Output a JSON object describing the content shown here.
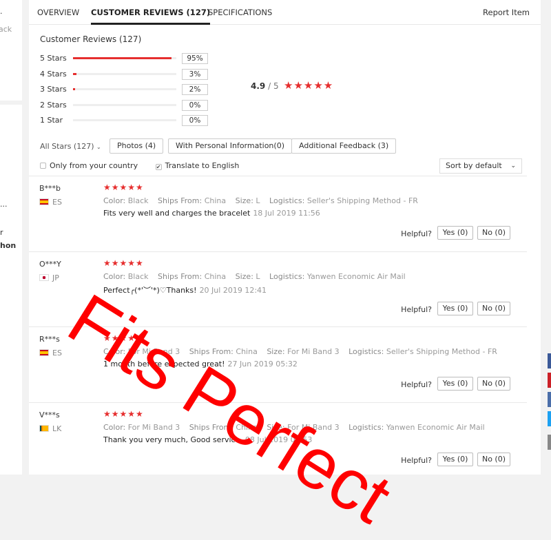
{
  "left_panel": {
    "fragments": [
      ".",
      "ack",
      "...",
      "r",
      "hon"
    ]
  },
  "tabs": [
    {
      "label": "OVERVIEW"
    },
    {
      "label": "CUSTOMER REVIEWS (127)"
    },
    {
      "label": "SPECIFICATIONS"
    }
  ],
  "report_label": "Report Item",
  "summary": {
    "title": "Customer Reviews (127)",
    "rows": [
      {
        "label": "5 Stars",
        "percent": 95,
        "percent_text": "95%"
      },
      {
        "label": "4 Stars",
        "percent": 3,
        "percent_text": "3%"
      },
      {
        "label": "3 Stars",
        "percent": 2,
        "percent_text": "2%"
      },
      {
        "label": "2 Stars",
        "percent": 0,
        "percent_text": "0%"
      },
      {
        "label": "1 Star",
        "percent": 0,
        "percent_text": "0%"
      }
    ],
    "score": "4.9",
    "score_max": "/ 5",
    "stars": "★★★★★"
  },
  "filters": {
    "all_stars": "All Stars (127)",
    "photos": "Photos (4)",
    "personal": "With Personal Information(0)",
    "additional": "Additional Feedback (3)",
    "only_country": "Only from your country",
    "translate": "Translate to English",
    "translate_checked": true,
    "sort": "Sort by default"
  },
  "helpful_label": "Helpful?",
  "reviews": [
    {
      "name": "B***b",
      "country": "ES",
      "stars": "★★★★★",
      "color_label": "Color:",
      "color": "Black",
      "ships_label": "Ships From:",
      "ships": "China",
      "size_label": "Size:",
      "size": "L",
      "logistics_label": "Logistics:",
      "logistics": "Seller's Shipping Method - FR",
      "text": "Fits very well and charges the bracelet",
      "date": "18 Jul 2019 11:56",
      "yes": "Yes (0)",
      "no": "No (0)"
    },
    {
      "name": "O***Y",
      "country": "JP",
      "stars": "★★★★★",
      "color_label": "Color:",
      "color": "Black",
      "ships_label": "Ships From:",
      "ships": "China",
      "size_label": "Size:",
      "size": "L",
      "logistics_label": "Logistics:",
      "logistics": "Yanwen Economic Air Mail",
      "text": "Perfect╭(*'︶'*)♡Thanks!",
      "date": "20 Jul 2019 12:41",
      "yes": "Yes (0)",
      "no": "No (0)"
    },
    {
      "name": "R***s",
      "country": "ES",
      "stars": "★★★★★",
      "color_label": "Color:",
      "color": "For Mi Band 3",
      "ships_label": "Ships From:",
      "ships": "China",
      "size_label": "Size:",
      "size": "For Mi Band 3",
      "logistics_label": "Logistics:",
      "logistics": "Seller's Shipping Method - FR",
      "text": "1 month before expected great!",
      "date": "27 Jun 2019 05:32",
      "yes": "Yes (0)",
      "no": "No (0)"
    },
    {
      "name": "V***s",
      "country": "LK",
      "stars": "★★★★★",
      "color_label": "Color:",
      "color": "For Mi Band 3",
      "ships_label": "Ships From:",
      "ships": "China",
      "size_label": "Size:",
      "size": "For Mi Band 3",
      "logistics_label": "Logistics:",
      "logistics": "Yanwen Economic Air Mail",
      "text": "Thank you very much, Good service.",
      "date": "08 Jul 2019 07:53",
      "yes": "Yes (0)",
      "no": "No (0)"
    }
  ],
  "overlay": {
    "text": "Fits Perfect",
    "color": "#ff0000"
  },
  "colors": {
    "accent": "#e62e2e",
    "social": [
      "#3b5998",
      "#cb2027",
      "#4a6ea9",
      "#1da1f2",
      "#888888"
    ]
  }
}
